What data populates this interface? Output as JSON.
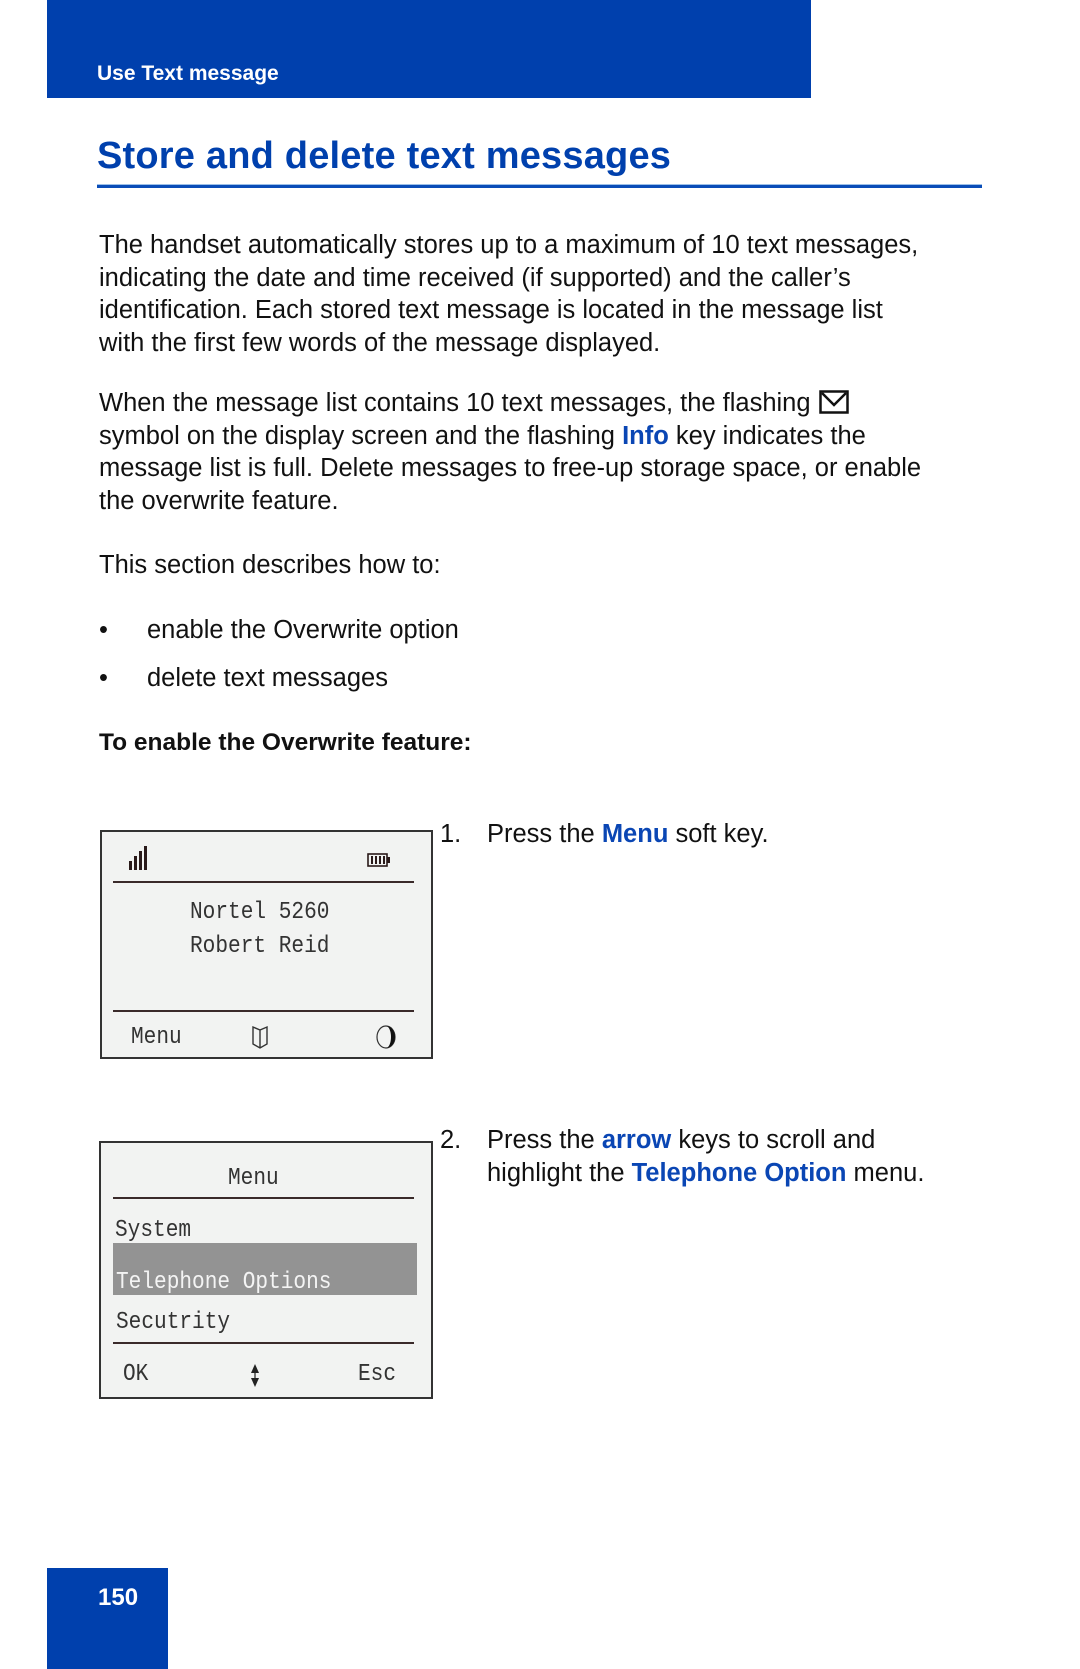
{
  "header": {
    "section_label": "Use Text message",
    "accent_color": "#0040ad"
  },
  "page_title": "Store and delete text messages",
  "body": {
    "paragraph1": [
      "The handset automatically stores up to a maximum of 10 text messages,",
      "indicating the date and time received (if supported) and the caller’s",
      "identification. Each stored text message is located in the message list",
      "with the first few words of the message displayed."
    ],
    "paragraph2": {
      "line1": "When the message list contains 10 text messages, the flashing",
      "line1_icon": "envelope-icon",
      "line2_pre": "symbol on the display screen and the flashing ",
      "line2_key": "Info",
      "line2_post": " key indicates the",
      "line3": "message list is full. Delete messages to free-up storage space, or enable",
      "line4": "the overwrite feature."
    },
    "intro": "This section describes how to:",
    "bullets": [
      "enable the Overwrite option",
      "delete text messages"
    ],
    "procedure_heading": "To enable the Overwrite feature:"
  },
  "steps": [
    {
      "number": "1.",
      "pre": "Press the ",
      "key": "Menu",
      "post": " soft key."
    },
    {
      "number": "2.",
      "line1_pre": "Press the ",
      "line1_key": "arrow",
      "line1_post": " keys to scroll and",
      "line2_pre": "highlight the ",
      "line2_key": "Telephone Option",
      "line2_post": " menu."
    }
  ],
  "display1": {
    "status_icons": [
      "signal-strength-icon",
      "battery-icon"
    ],
    "line1": "Nortel 5260",
    "line2": "Robert Reid",
    "softkey_left": "Menu",
    "softkey_center_icon": "directory-book-icon",
    "softkey_right_icon": "half-moon-icon"
  },
  "display2": {
    "title": "Menu",
    "items": [
      "System",
      "Telephone Options",
      "Secutrity"
    ],
    "selected_index": 1,
    "softkey_left": "OK",
    "softkey_center_icon": "up-down-arrow-icon",
    "softkey_right": "Esc"
  },
  "footer": {
    "page_number": "150"
  }
}
